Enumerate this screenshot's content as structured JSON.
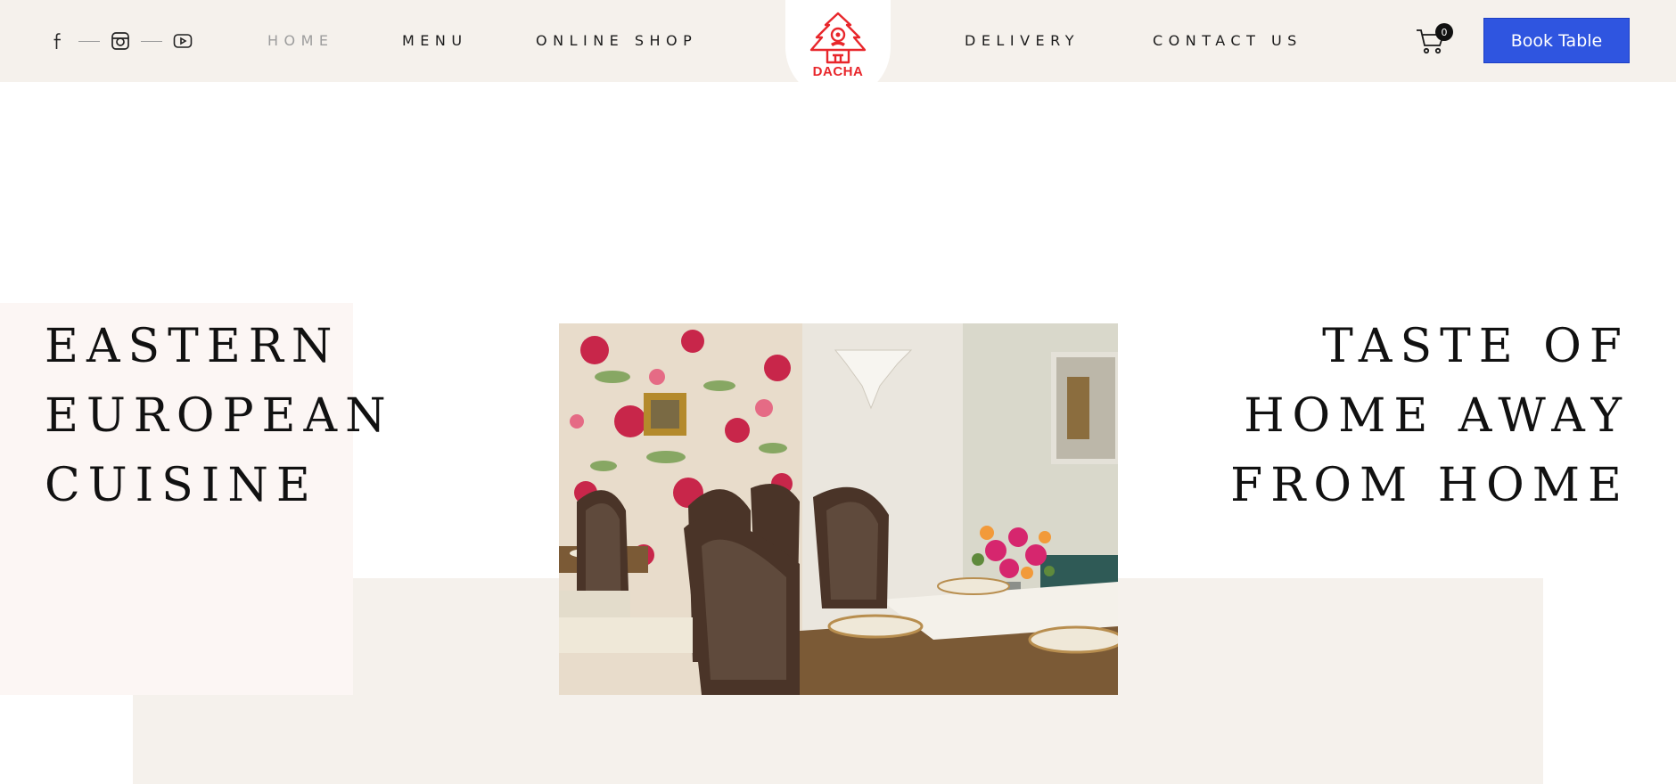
{
  "header": {
    "social": [
      {
        "icon": "facebook-icon"
      },
      {
        "icon": "instagram-icon"
      },
      {
        "icon": "youtube-icon"
      }
    ],
    "nav": {
      "home": "HOME",
      "menu": "MENU",
      "online_shop": "ONLINE SHOP",
      "delivery": "DELIVERY",
      "contact_us": "CONTACT US"
    },
    "logo_text": "DACHA",
    "cart_count": "0",
    "book_button": "Book Table"
  },
  "hero": {
    "left_headline": [
      "EASTERN",
      "EUROPEAN",
      "CUISINE"
    ],
    "right_headline": [
      "TASTE OF",
      "HOME AWAY",
      "FROM HOME"
    ]
  },
  "colors": {
    "header_bg": "#f5f1ec",
    "accent_button": "#2f55e0",
    "logo_red": "#e8262b",
    "panel_pink": "#fcf6f4"
  }
}
